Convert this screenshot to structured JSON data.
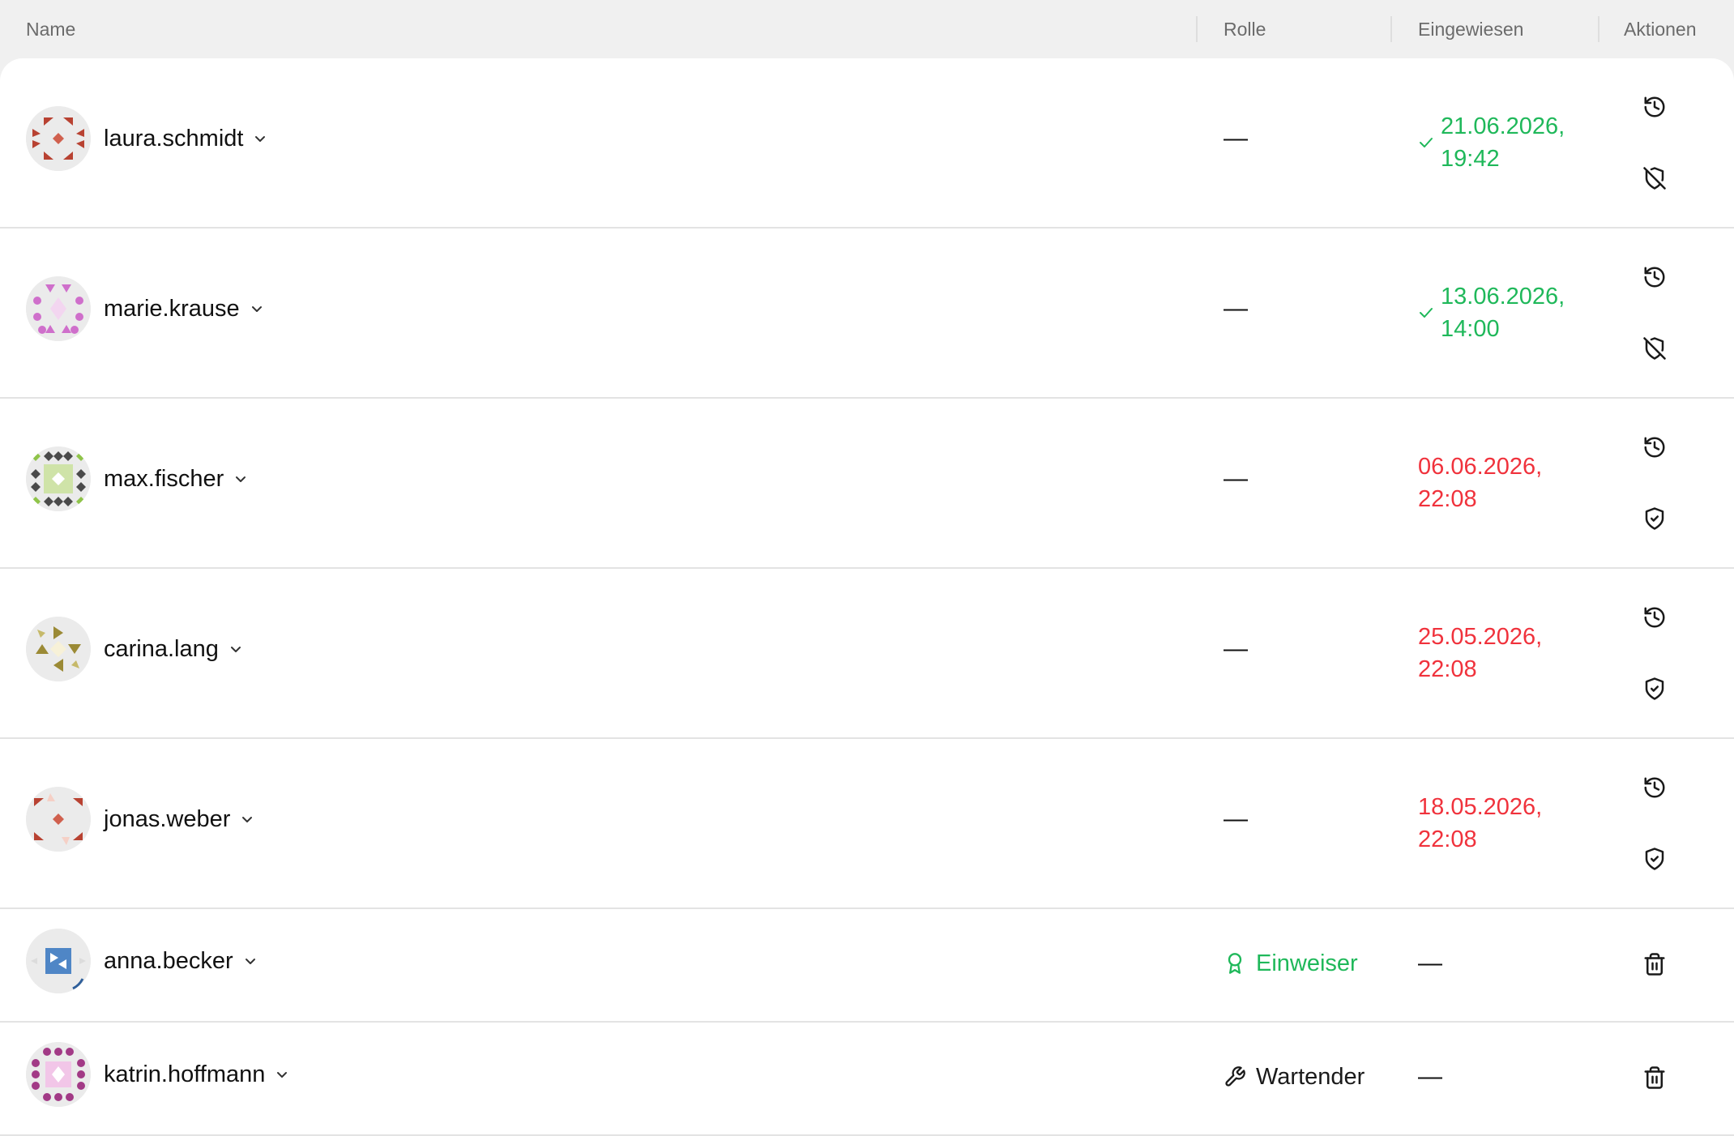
{
  "columns": {
    "name": "Name",
    "role": "Rolle",
    "inducted": "Eingewiesen",
    "actions": "Aktionen"
  },
  "empty_value": "—",
  "colors": {
    "ok": "#1fb85a",
    "overdue": "#f0323c"
  },
  "rows": [
    {
      "username": "laura.schmidt",
      "role": "",
      "date_line1": "21.06.2026,",
      "date_line2": "19:42",
      "status": "ok",
      "actions": [
        "history-icon",
        "shield-off-icon"
      ]
    },
    {
      "username": "marie.krause",
      "role": "",
      "date_line1": "13.06.2026,",
      "date_line2": "14:00",
      "status": "ok",
      "actions": [
        "history-icon",
        "shield-off-icon"
      ]
    },
    {
      "username": "max.fischer",
      "role": "",
      "date_line1": "06.06.2026,",
      "date_line2": "22:08",
      "status": "overdue",
      "actions": [
        "history-icon",
        "shield-check-icon"
      ]
    },
    {
      "username": "carina.lang",
      "role": "",
      "date_line1": "25.05.2026,",
      "date_line2": "22:08",
      "status": "overdue",
      "actions": [
        "history-icon",
        "shield-check-icon"
      ]
    },
    {
      "username": "jonas.weber",
      "role": "",
      "date_line1": "18.05.2026,",
      "date_line2": "22:08",
      "status": "overdue",
      "actions": [
        "history-icon",
        "shield-check-icon"
      ]
    },
    {
      "username": "anna.becker",
      "role": "Einweiser",
      "role_icon": "award-icon",
      "date_line1": "",
      "date_line2": "",
      "status": "none",
      "actions": [
        "trash-icon"
      ]
    },
    {
      "username": "katrin.hoffmann",
      "role": "Wartender",
      "role_icon": "wrench-icon",
      "date_line1": "",
      "date_line2": "",
      "status": "none",
      "actions": [
        "trash-icon"
      ]
    }
  ]
}
